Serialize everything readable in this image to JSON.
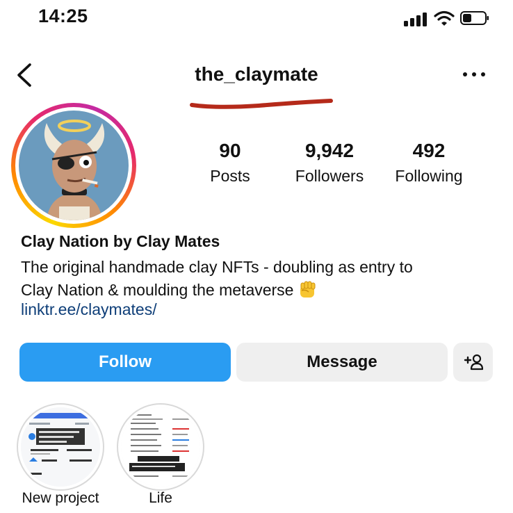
{
  "status_bar": {
    "time": "14:25"
  },
  "header": {
    "username": "the_claymate"
  },
  "stats": [
    {
      "value": "90",
      "label": "Posts"
    },
    {
      "value": "9,942",
      "label": "Followers"
    },
    {
      "value": "492",
      "label": "Following"
    }
  ],
  "bio": {
    "display_name": "Clay Nation by Clay Mates",
    "line1": "The original handmade clay NFTs - doubling as entry to",
    "line2": "Clay Nation & moulding the metaverse",
    "emoji": "raised-fist-emoji",
    "link": "linktr.ee/claymates/"
  },
  "actions": {
    "follow": "Follow",
    "message": "Message"
  },
  "highlights": [
    {
      "label": "New project"
    },
    {
      "label": "Life"
    }
  ],
  "colors": {
    "follow_button": "#2a9cf2",
    "secondary_button": "#efefef",
    "link": "#0e3e78",
    "underline_annotation": "#b52a1a"
  }
}
